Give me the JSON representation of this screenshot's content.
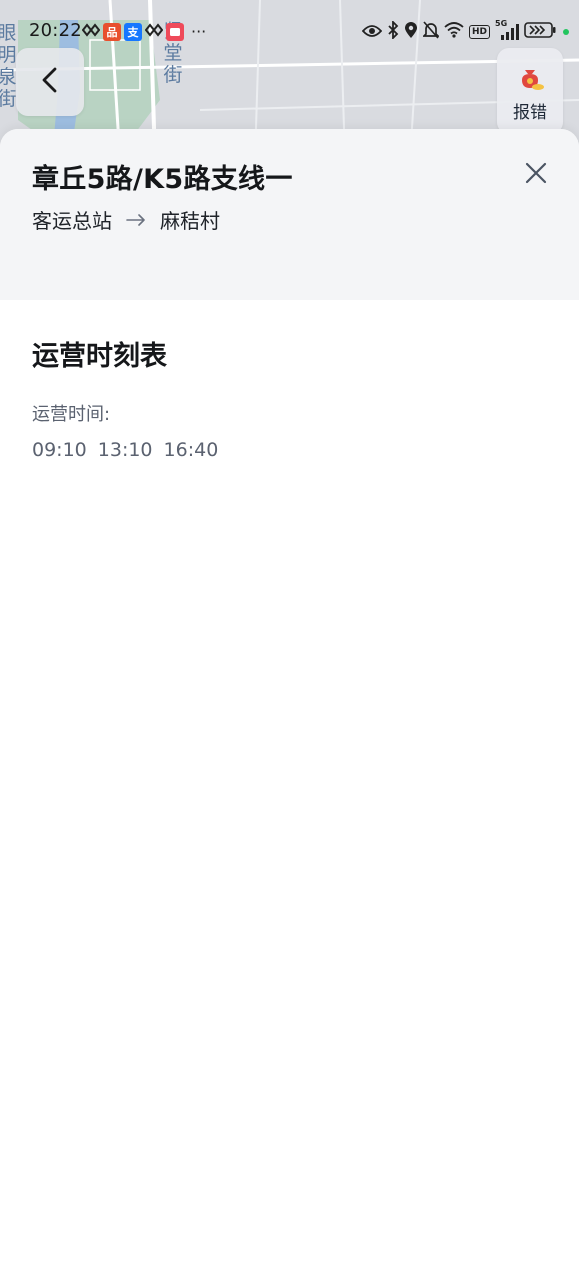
{
  "status_bar": {
    "time": "20:22",
    "overflow": "···",
    "hd_label": "HD",
    "network_label": "5G",
    "left_icons": [
      "notification-icon",
      "pinduoduo-app-icon",
      "alipay-app-icon",
      "notification-icon",
      "message-app-icon"
    ],
    "app_badges": {
      "pinduoduo_text": "品",
      "alipay_text": "支",
      "message_text": ""
    },
    "right_icons": [
      "eye-icon",
      "bluetooth-icon",
      "location-icon",
      "mute-icon",
      "wifi-icon",
      "hd-icon",
      "signal-icon",
      "battery-icon"
    ]
  },
  "map": {
    "label_left": "眼明泉街",
    "label_right": "贤堂街"
  },
  "controls": {
    "back_icon": "chevron-left-icon",
    "report_label": "报错",
    "report_icon": "money-bag-icon"
  },
  "route": {
    "name": "章丘5路/K5路支线一",
    "origin": "客运总站",
    "destination": "麻秸村"
  },
  "schedule": {
    "title": "运营时刻表",
    "operating_label": "运营时间:",
    "times": [
      "09:10",
      "13:10",
      "16:40"
    ]
  },
  "colors": {
    "accent_text": "#15171a",
    "secondary_text": "#5b6270",
    "header_bg": "#f4f5f7",
    "map_bg": "#d9dbe0",
    "map_label": "#5c7ba0"
  }
}
